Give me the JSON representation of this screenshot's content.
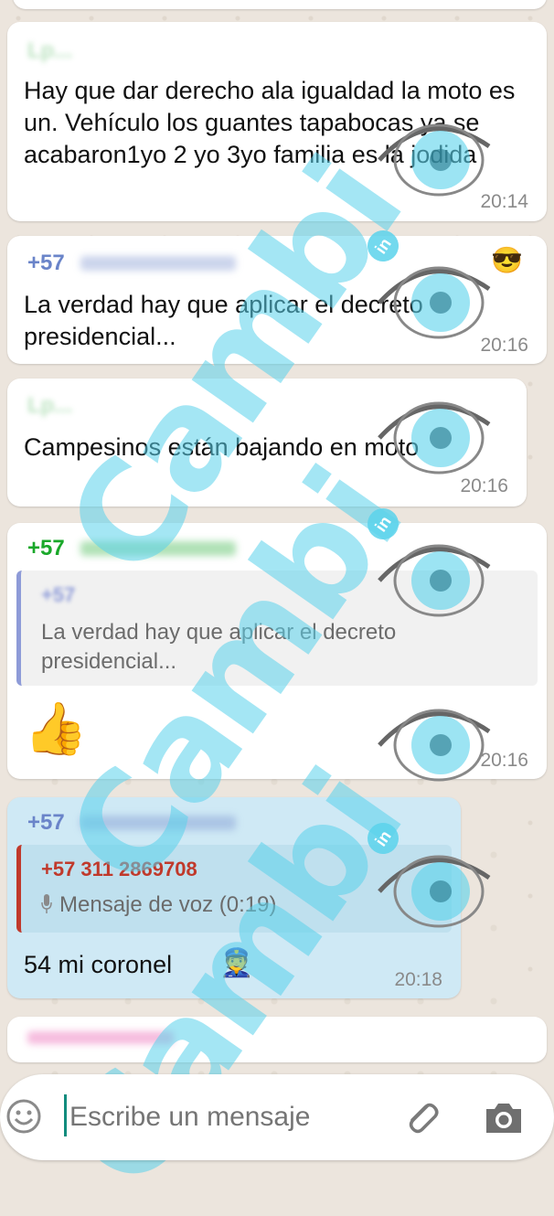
{
  "messages": [
    {
      "sender": "Lp...",
      "text": "Hay que dar derecho ala igualdad la moto es un. Vehículo  los guantes tapabocas ya se acabaron1yo 2 yo 3yo familia es la jodida",
      "time": "20:14"
    },
    {
      "sender": "+57",
      "text": "La verdad hay que aplicar  el decreto presidencial...",
      "time": "20:16",
      "emoji": "😎"
    },
    {
      "sender": "Lp...",
      "text": "Campesinos están bajando en moto",
      "time": "20:16"
    },
    {
      "sender": "+57",
      "quote_sender": "+57",
      "quote_text": "La verdad hay que aplicar  el decreto presidencial...",
      "emoji": "👍",
      "time": "20:16"
    },
    {
      "sender": "+57",
      "quote_sender": "+57 311 2869708",
      "quote_text": "Mensaje de voz (0:19)",
      "text": "54 mi coronel",
      "emoji": "👮",
      "time": "20:18"
    }
  ],
  "input": {
    "placeholder": "Escribe un mensaje"
  },
  "watermark": {
    "text": "Cambi",
    "badge": "in"
  },
  "colors": {
    "sender_blue": "#6a84c9",
    "sender_green": "#1aa82a",
    "quote_red": "#c0392b",
    "watermark": "#5ad2eb"
  }
}
